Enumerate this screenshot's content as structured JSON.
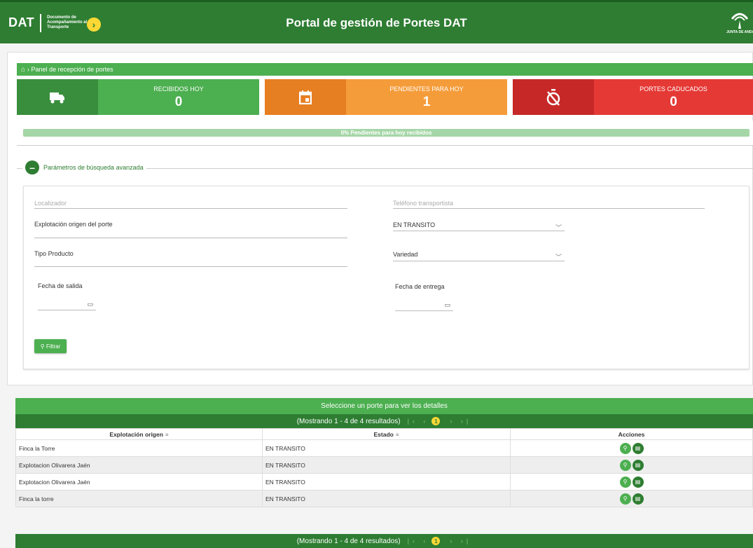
{
  "header": {
    "logo": "DAT",
    "logo_sub": "Documento de Acompañamiento al Transporte",
    "title": "Portal de gestión de Portes DAT",
    "org": "JUNTA DE ANDALUCÍA"
  },
  "breadcrumb": "Panel de recepción de portes",
  "stats": [
    {
      "label": "RECIBIDOS HOY",
      "value": "0",
      "icon": "truck-icon",
      "color": "#4caf50"
    },
    {
      "label": "PENDIENTES PARA HOY",
      "value": "1",
      "icon": "calendar-icon",
      "color": "#f59c3a"
    },
    {
      "label": "PORTES CADUCADOS",
      "value": "0",
      "icon": "timer-off-icon",
      "color": "#e53935"
    }
  ],
  "progress": {
    "text": "0% Pendientes para hoy recibidos",
    "percent": 0
  },
  "search": {
    "legend": "Parámetros de búsqueda avanzada",
    "localizador_placeholder": "Localizador",
    "telefono_placeholder": "Teléfono transportista",
    "explotacion_placeholder": "Explotación origen del porte",
    "estado_value": "EN TRANSITO",
    "tipo_producto_placeholder": "Tipo Producto",
    "variedad_placeholder": "Variedad",
    "fecha_salida_label": "Fecha de salida",
    "fecha_entrega_label": "Fecha de entrega",
    "filter_button": "Filtrar"
  },
  "table": {
    "title": "Seleccione un porte para ver los detalles",
    "pager_text": "(Mostrando 1 - 4 de 4 resultados)",
    "current_page": "1",
    "columns": [
      "Explotación origen",
      "Estado",
      "Acciones"
    ],
    "rows": [
      {
        "explotacion": "Finca la Torre",
        "estado": "EN TRANSITO"
      },
      {
        "explotacion": "Explotacion Olivarera Jaén",
        "estado": "EN TRANSITO"
      },
      {
        "explotacion": "Explotacion Olivarera Jaén",
        "estado": "EN TRANSITO"
      },
      {
        "explotacion": "Finca la torre",
        "estado": "EN TRANSITO"
      }
    ]
  }
}
